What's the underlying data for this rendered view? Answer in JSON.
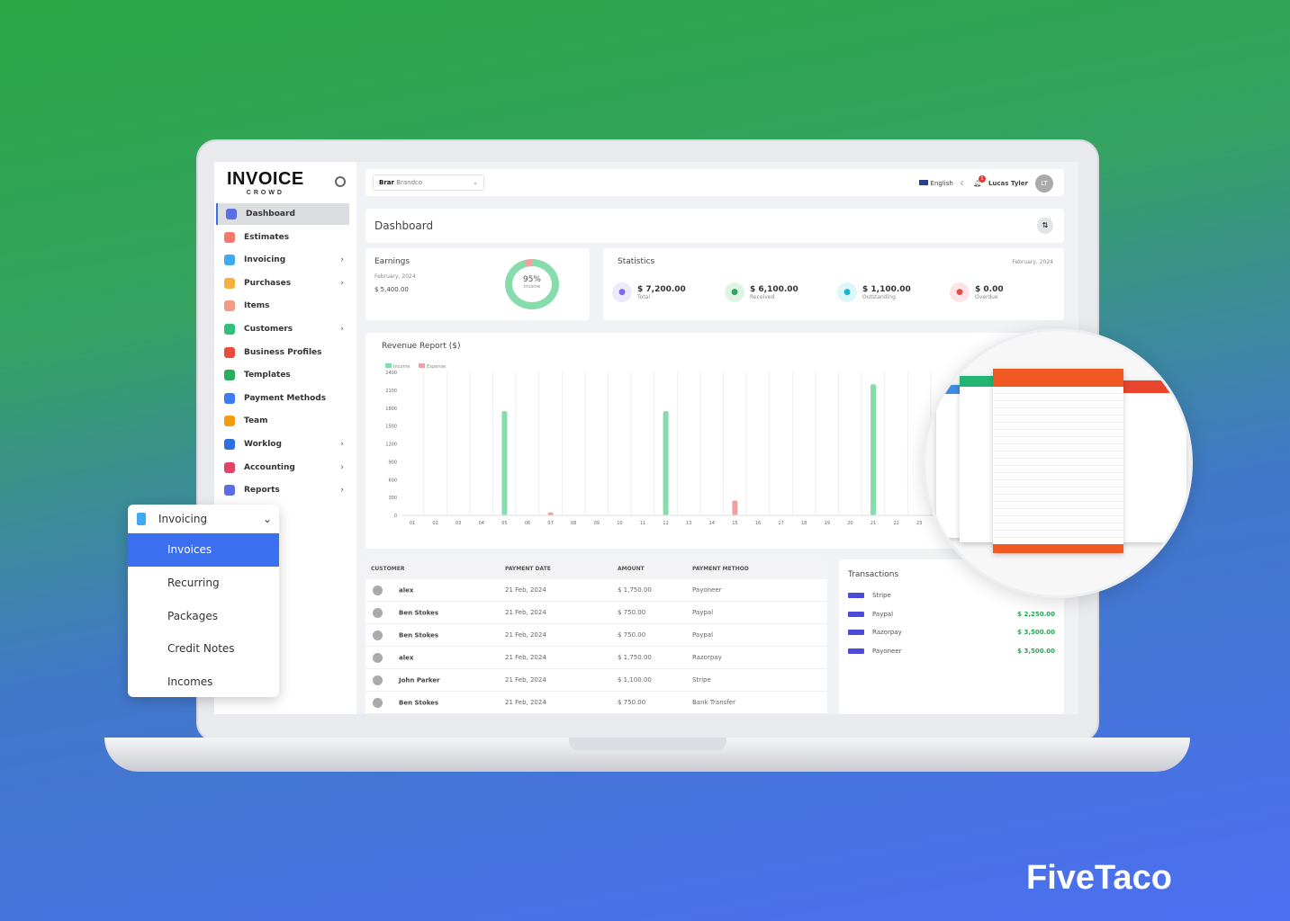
{
  "brand": {
    "logo_main": "INVOICE",
    "logo_sub": "CROWD",
    "footer": "FiveTaco"
  },
  "sidebar": {
    "items": [
      {
        "label": "Dashboard",
        "icon": "home-icon",
        "color": "#5b6ee8",
        "active": true
      },
      {
        "label": "Estimates",
        "icon": "pie-icon",
        "color": "#f27a6b"
      },
      {
        "label": "Invoicing",
        "icon": "file-icon",
        "color": "#3fa9f5",
        "chevron": true
      },
      {
        "label": "Purchases",
        "icon": "bag-icon",
        "color": "#f5b041",
        "chevron": true
      },
      {
        "label": "Items",
        "icon": "items-icon",
        "color": "#f29b85"
      },
      {
        "label": "Customers",
        "icon": "users-icon",
        "color": "#2ec27e",
        "chevron": true
      },
      {
        "label": "Business Profiles",
        "icon": "briefcase-icon",
        "color": "#e74c3c"
      },
      {
        "label": "Templates",
        "icon": "template-icon",
        "color": "#27ae60"
      },
      {
        "label": "Payment Methods",
        "icon": "card-icon",
        "color": "#3d7cf0"
      },
      {
        "label": "Team",
        "icon": "team-icon",
        "color": "#f39c12"
      },
      {
        "label": "Worklog",
        "icon": "calendar-icon",
        "color": "#2f6ee0",
        "chevron": true
      },
      {
        "label": "Accounting",
        "icon": "book-icon",
        "color": "#e0436b",
        "chevron": true
      },
      {
        "label": "Reports",
        "icon": "report-icon",
        "color": "#5b6ee8",
        "chevron": true
      }
    ]
  },
  "topbar": {
    "company": "Brandco",
    "language": "English",
    "notifications": "1",
    "user": "Lucas Tyler",
    "initials": "LT"
  },
  "page_title": "Dashboard",
  "earnings": {
    "title": "Earnings",
    "period": "February, 2024",
    "amount": "$ 5,400.00",
    "percent": "95%",
    "percent_label": "Income",
    "income_fraction": 0.95
  },
  "statistics": {
    "title": "Statistics",
    "period": "February, 2024",
    "items": [
      {
        "value": "$ 7,200.00",
        "label": "Total",
        "icon": "trend-icon",
        "bg": "#ece9fb",
        "fg": "#7b68ee"
      },
      {
        "value": "$ 6,100.00",
        "label": "Received",
        "icon": "dollar-icon",
        "bg": "#def5e6",
        "fg": "#2ea55a"
      },
      {
        "value": "$ 1,100.00",
        "label": "Outstanding",
        "icon": "user-icon",
        "bg": "#dcf6fa",
        "fg": "#17b6d0"
      },
      {
        "value": "$ 0.00",
        "label": "Overdue",
        "icon": "box-icon",
        "bg": "#fde4e4",
        "fg": "#e74c4c"
      }
    ]
  },
  "chart_data": {
    "type": "bar",
    "title": "Revenue Report ($)",
    "legend_position": "top-left",
    "categories": [
      "01",
      "02",
      "03",
      "04",
      "05",
      "06",
      "07",
      "08",
      "09",
      "10",
      "11",
      "12",
      "13",
      "14",
      "15",
      "16",
      "17",
      "18",
      "19",
      "20",
      "21",
      "22",
      "23"
    ],
    "ylim": [
      0,
      2400
    ],
    "yticks": [
      0,
      300,
      600,
      900,
      1200,
      1500,
      1800,
      2100,
      2400
    ],
    "grid": true,
    "series": [
      {
        "name": "Income",
        "color": "#86dcaa",
        "values": [
          0,
          0,
          0,
          0,
          1750,
          0,
          0,
          0,
          0,
          0,
          0,
          1750,
          0,
          0,
          0,
          0,
          0,
          0,
          0,
          0,
          2200,
          0,
          0
        ]
      },
      {
        "name": "Expense",
        "color": "#f0a0a0",
        "values": [
          0,
          0,
          0,
          0,
          0,
          0,
          50,
          0,
          0,
          0,
          0,
          0,
          0,
          0,
          250,
          0,
          0,
          0,
          0,
          0,
          0,
          0,
          0
        ]
      }
    ]
  },
  "payments": {
    "headers": [
      "CUSTOMER",
      "PAYMENT DATE",
      "AMOUNT",
      "PAYMENT METHOD"
    ],
    "rows": [
      [
        "alex",
        "21 Feb, 2024",
        "$ 1,750.00",
        "Payoneer"
      ],
      [
        "Ben Stokes",
        "21 Feb, 2024",
        "$ 750.00",
        "Paypal"
      ],
      [
        "Ben Stokes",
        "21 Feb, 2024",
        "$ 750.00",
        "Paypal"
      ],
      [
        "alex",
        "21 Feb, 2024",
        "$ 1,750.00",
        "Razorpay"
      ],
      [
        "John Parker",
        "21 Feb, 2024",
        "$ 1,100.00",
        "Stripe"
      ],
      [
        "Ben Stokes",
        "21 Feb, 2024",
        "$ 750.00",
        "Bank Transfer"
      ]
    ]
  },
  "transactions": {
    "title": "Transactions",
    "items": [
      {
        "name": "Stripe",
        "amount": ""
      },
      {
        "name": "Paypal",
        "amount": "$ 2,250.00"
      },
      {
        "name": "Razorpay",
        "amount": "$ 3,500.00"
      },
      {
        "name": "Payoneer",
        "amount": "$ 3,500.00"
      }
    ]
  },
  "popup": {
    "title": "Invoicing",
    "items": [
      "Invoices",
      "Recurring",
      "Packages",
      "Credit Notes",
      "Incomes"
    ],
    "active": "Invoices",
    "accent": "#3a6ff0"
  }
}
